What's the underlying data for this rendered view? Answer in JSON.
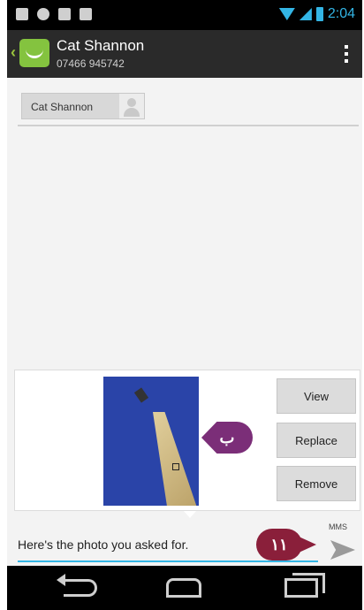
{
  "status_bar": {
    "time": "2:04"
  },
  "action_bar": {
    "contact_name": "Cat Shannon",
    "contact_number": "07466 945742"
  },
  "recipient": {
    "chip_label": "Cat Shannon"
  },
  "attachment": {
    "buttons": {
      "view": "View",
      "replace": "Replace",
      "remove": "Remove"
    }
  },
  "callouts": {
    "marker_b": "ب",
    "marker_11": "١١"
  },
  "compose": {
    "message": "Here's the photo you asked for.",
    "mms_label": "MMS"
  },
  "colors": {
    "accent": "#33b5e5",
    "marker_purple": "#7b2e78",
    "marker_red": "#8a1f3a",
    "app_icon_green": "#84c33f"
  },
  "icons": [
    "wifi-icon",
    "signal-icon",
    "battery-icon",
    "overflow-menu-icon",
    "send-icon",
    "nav-back-icon",
    "nav-home-icon",
    "nav-recent-icon"
  ]
}
